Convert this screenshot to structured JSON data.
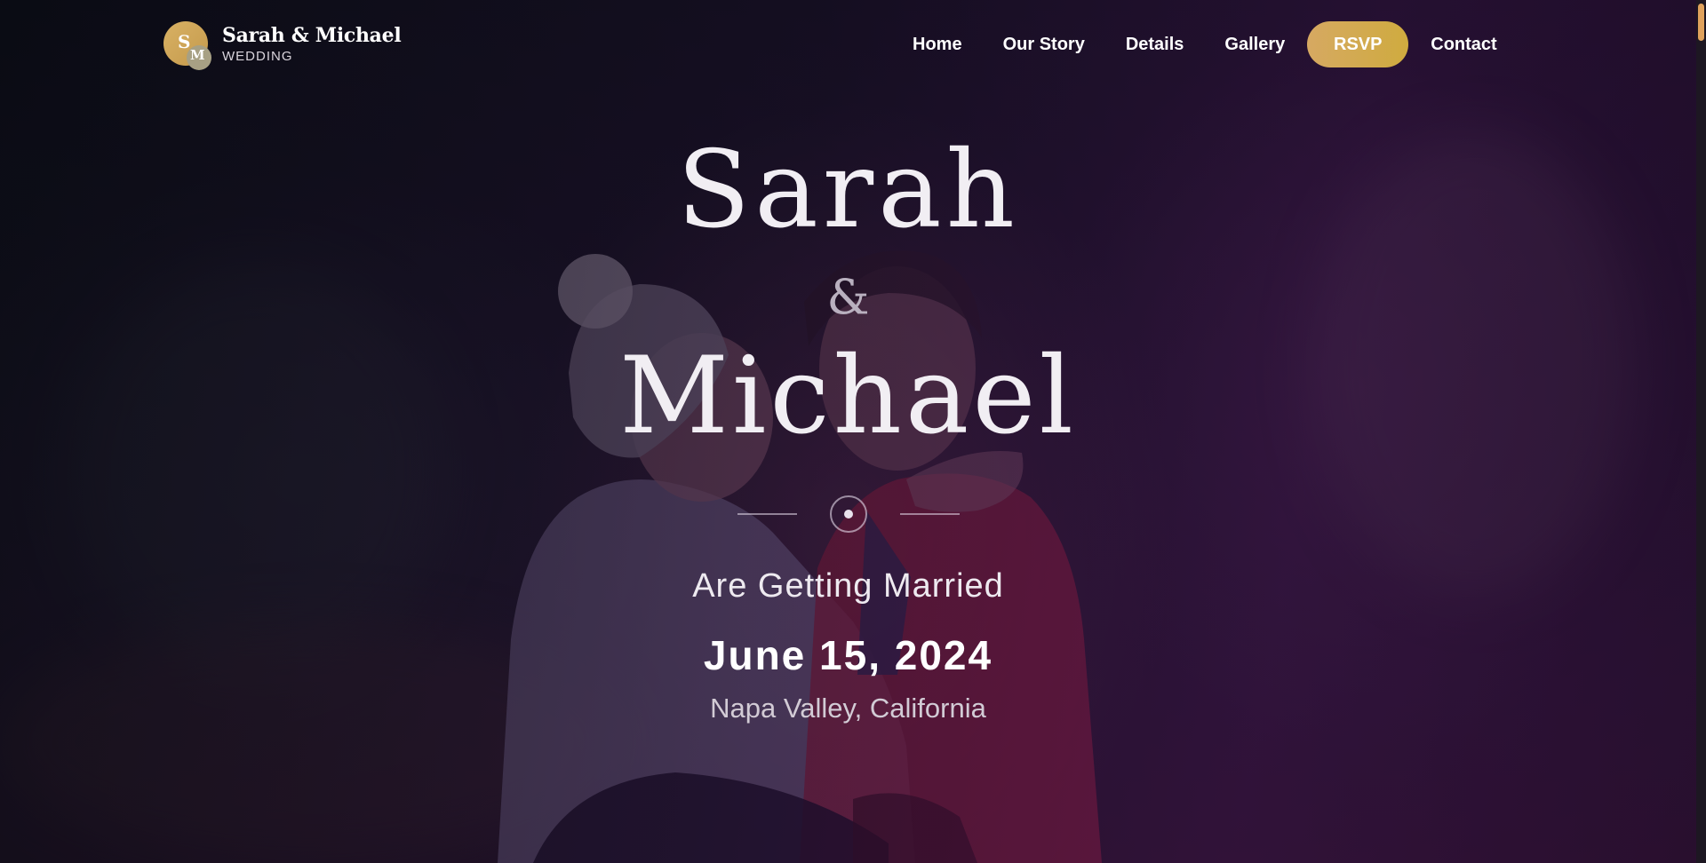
{
  "header": {
    "logo": {
      "monogram_primary": "S",
      "monogram_secondary": "M",
      "title": "Sarah & Michael",
      "subtitle": "WEDDING"
    },
    "nav": {
      "items": [
        {
          "label": "Home"
        },
        {
          "label": "Our Story"
        },
        {
          "label": "Details"
        },
        {
          "label": "Gallery"
        },
        {
          "label": "RSVP",
          "style": "pill-button"
        },
        {
          "label": "Contact"
        }
      ]
    }
  },
  "hero": {
    "name_first": "Sarah",
    "ampersand": "&",
    "name_second": "Michael",
    "tagline": "Are Getting Married",
    "date": "June 15, 2024",
    "location": "Napa Valley, California",
    "background": "couple-photo-with-purple-overlay"
  },
  "colors": {
    "accent_gold": "#d6a962",
    "text_primary": "#ffffff",
    "overlay_purple": "#3a1450",
    "scrollbar_thumb": "#e0a25c"
  },
  "icons": {
    "divider": "ring-dot-ornament"
  }
}
